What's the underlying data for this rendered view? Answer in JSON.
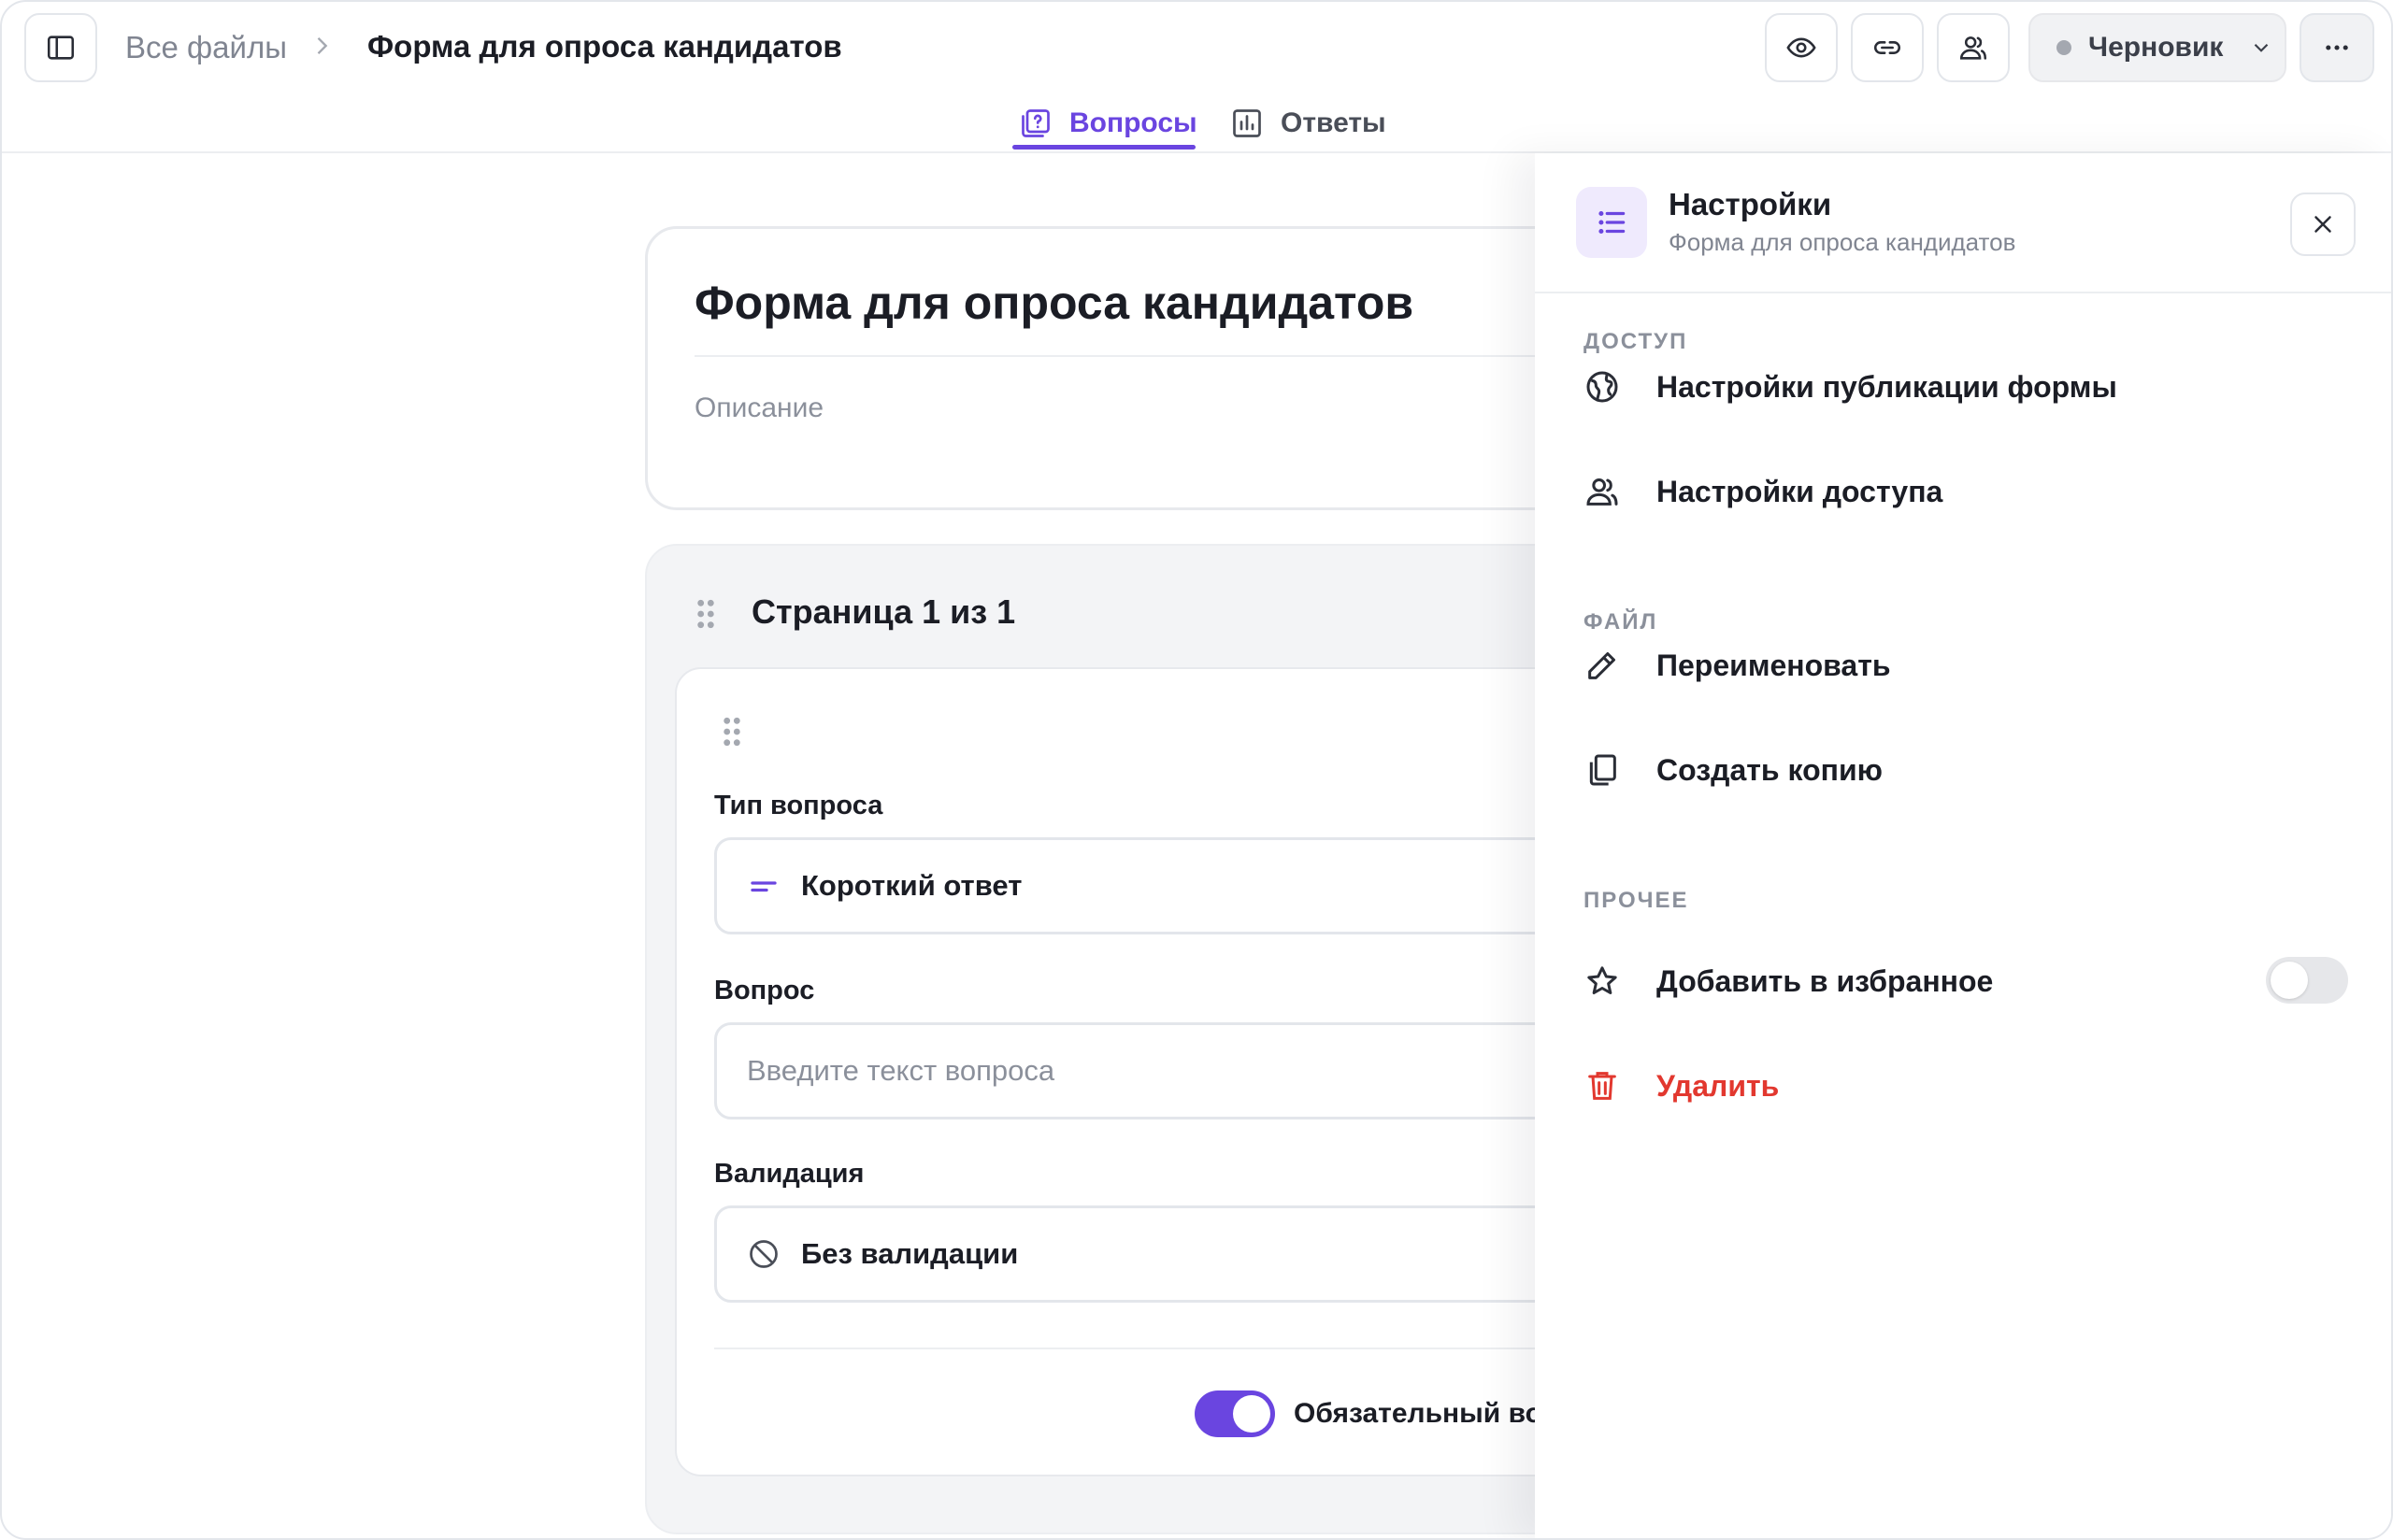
{
  "header": {
    "breadcrumb_root": "Все файлы",
    "breadcrumb_current": "Форма для опроса кандидатов",
    "status_label": "Черновик"
  },
  "tabs": [
    {
      "label": "Вопросы",
      "active": true,
      "icon": "question-doc-icon"
    },
    {
      "label": "Ответы",
      "active": false,
      "icon": "bar-chart-icon"
    }
  ],
  "form": {
    "title": "Форма для опроса кандидатов",
    "description_placeholder": "Описание",
    "page_title": "Страница 1 из 1"
  },
  "question": {
    "type_label": "Тип вопроса",
    "type_value": "Короткий ответ",
    "question_label": "Вопрос",
    "question_placeholder": "Введите текст вопроса",
    "validation_label": "Валидация",
    "validation_value": "Без валидации",
    "required_label": "Обязательный вопрос",
    "required_on": true
  },
  "settings": {
    "title": "Настройки",
    "subtitle": "Форма для опроса кандидатов",
    "sections": [
      {
        "label": "ДОСТУП",
        "items": [
          {
            "label": "Настройки публикации формы",
            "icon": "globe-icon"
          },
          {
            "label": "Настройки доступа",
            "icon": "users-icon"
          }
        ]
      },
      {
        "label": "ФАЙЛ",
        "items": [
          {
            "label": "Переименовать",
            "icon": "pencil-icon"
          },
          {
            "label": "Создать копию",
            "icon": "copy-icon"
          }
        ]
      },
      {
        "label": "ПРОЧЕЕ",
        "items": [
          {
            "label": "Добавить в избранное",
            "icon": "star-icon",
            "toggle": false
          },
          {
            "label": "Удалить",
            "icon": "trash-icon",
            "danger": true
          }
        ]
      }
    ]
  },
  "colors": {
    "accent": "#6a45e0",
    "danger": "#e2382f",
    "muted_text": "#808591",
    "border": "#e3e6eb"
  }
}
